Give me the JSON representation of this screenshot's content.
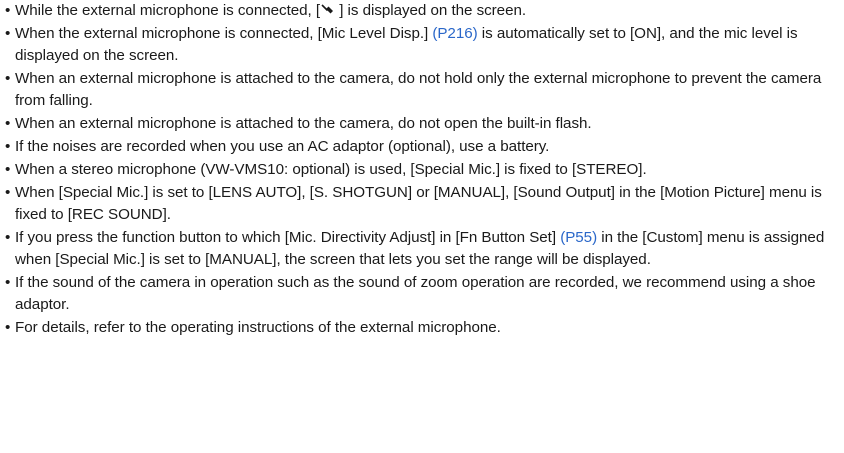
{
  "icons": {
    "mic": "external-microphone-icon"
  },
  "notes": [
    {
      "segments": [
        "While the external microphone is connected, [",
        "",
        " ] is displayed on the screen."
      ]
    },
    {
      "pre": "When the external microphone is connected, [Mic Level Disp.] ",
      "link": "(P216)",
      "post": " is automatically set to [ON], and the mic level is displayed on the screen."
    },
    {
      "text": "When an external microphone is attached to the camera, do not hold only the external microphone to prevent the camera from falling."
    },
    {
      "text": "When an external microphone is attached to the camera, do not open the built-in flash."
    },
    {
      "text": "If the noises are recorded when you use an AC adaptor (optional), use a battery."
    },
    {
      "text": "When a stereo microphone (VW-VMS10: optional) is used, [Special Mic.] is fixed to [STEREO]."
    },
    {
      "text": "When [Special Mic.] is set to [LENS AUTO], [S. SHOTGUN] or [MANUAL], [Sound Output] in the [Motion Picture] menu is fixed to [REC SOUND]."
    },
    {
      "pre": "If you press the function button to which [Mic. Directivity Adjust] in [Fn Button Set] ",
      "link": "(P55)",
      "post": " in the [Custom] menu is assigned when [Special Mic.] is set to [MANUAL], the screen that lets you set the range will be displayed."
    },
    {
      "text": "If the sound of the camera in operation such as the sound of zoom operation are recorded, we recommend using a shoe adaptor."
    },
    {
      "text": "For details, refer to the operating instructions of the external microphone."
    }
  ],
  "bullet": "•"
}
